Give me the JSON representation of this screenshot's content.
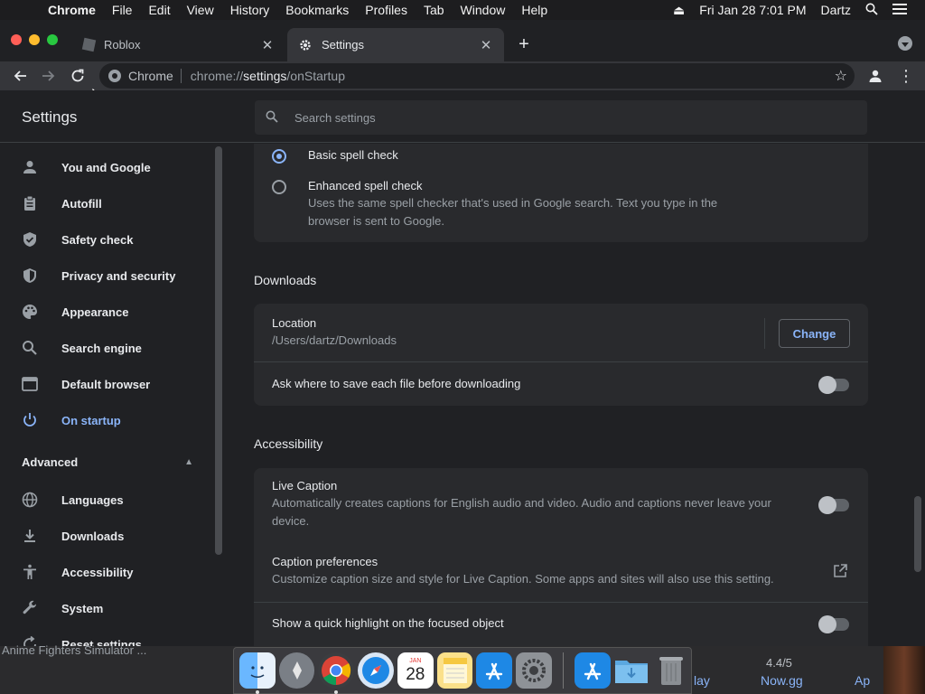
{
  "menubar": {
    "app_name": "Chrome",
    "items": [
      "File",
      "Edit",
      "View",
      "History",
      "Bookmarks",
      "Profiles",
      "Tab",
      "Window",
      "Help"
    ],
    "clock": "Fri Jan 28  7:01 PM",
    "user": "Dartz"
  },
  "tabs": {
    "inactive_title": "Roblox",
    "active_title": "Settings",
    "close_glyph": "✕",
    "new_tab_glyph": "+"
  },
  "omnibox": {
    "chip": "Chrome",
    "url_scheme": "chrome://",
    "url_host": "settings",
    "url_path": "/onStartup"
  },
  "settings": {
    "title": "Settings",
    "search_placeholder": "Search settings"
  },
  "sidebar": {
    "items": [
      {
        "label": "You and Google",
        "icon": "person-icon"
      },
      {
        "label": "Autofill",
        "icon": "clipboard-icon"
      },
      {
        "label": "Safety check",
        "icon": "shield-check-icon"
      },
      {
        "label": "Privacy and security",
        "icon": "shield-icon"
      },
      {
        "label": "Appearance",
        "icon": "palette-icon"
      },
      {
        "label": "Search engine",
        "icon": "search-icon"
      },
      {
        "label": "Default browser",
        "icon": "browser-icon"
      },
      {
        "label": "On startup",
        "icon": "power-icon",
        "active": true
      }
    ],
    "advanced_label": "Advanced",
    "advanced_items": [
      {
        "label": "Languages",
        "icon": "globe-icon"
      },
      {
        "label": "Downloads",
        "icon": "download-icon"
      },
      {
        "label": "Accessibility",
        "icon": "accessibility-icon"
      },
      {
        "label": "System",
        "icon": "wrench-icon"
      },
      {
        "label": "Reset settings",
        "icon": "reset-icon"
      }
    ]
  },
  "spellcheck": {
    "basic_label": "Basic spell check",
    "enhanced_label": "Enhanced spell check",
    "enhanced_desc_line1": "Uses the same spell checker that's used in Google search. Text you type in the",
    "enhanced_desc_line2": "browser is sent to Google.",
    "selected": "basic"
  },
  "downloads": {
    "section_title": "Downloads",
    "location_label": "Location",
    "location_value": "/Users/dartz/Downloads",
    "change_button": "Change",
    "ask_label": "Ask where to save each file before downloading",
    "ask_enabled": false
  },
  "accessibility": {
    "section_title": "Accessibility",
    "live_caption_label": "Live Caption",
    "live_caption_desc_line1": "Automatically creates captions for English audio and video. Audio and captions never leave your",
    "live_caption_desc_line2": "device.",
    "live_caption_enabled": false,
    "caption_prefs_label": "Caption preferences",
    "caption_prefs_desc": "Customize caption size and style for Live Caption. Some apps and sites will also use this setting.",
    "highlight_label": "Show a quick highlight on the focused object",
    "highlight_enabled": false
  },
  "dock": {
    "calendar_month": "JAN",
    "calendar_day": "28",
    "items": [
      "finder-icon",
      "launchpad-icon",
      "chrome-icon",
      "safari-icon",
      "calendar-icon",
      "notes-icon",
      "app-store-icon",
      "system-preferences-icon",
      "app-store-icon",
      "downloads-folder-icon",
      "trash-icon"
    ]
  },
  "background": {
    "game_text": "Anime Fighters Simulator ...",
    "play_text": "lay",
    "rating": "4.4/5",
    "nowgg": "Now.gg",
    "ap_text": "Ap"
  },
  "colors": {
    "accent": "#8ab4f8",
    "background": "#202124",
    "card": "#292a2d"
  }
}
